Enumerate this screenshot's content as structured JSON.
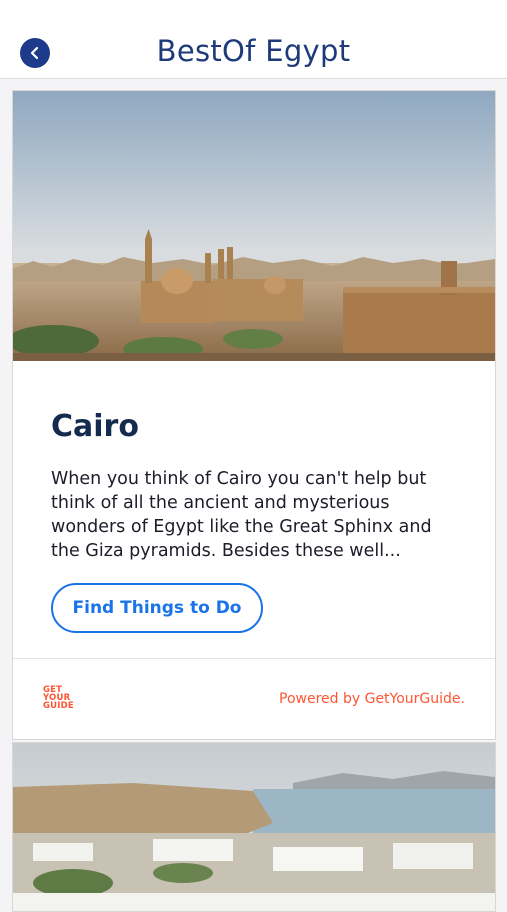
{
  "header": {
    "title": "BestOf Egypt",
    "back_icon": "chevron-left-icon"
  },
  "card": {
    "title": "Cairo",
    "description": "When you think of Cairo you can't help but think of all the ancient and mysterious wonders of Egypt like the Great Sphinx and the Giza pyramids. Besides these well...",
    "button_label": "Find Things to Do",
    "logo_lines": [
      "GET",
      "YOUR",
      "GUIDE"
    ],
    "powered_text": "Powered by GetYourGuide."
  },
  "colors": {
    "header_title": "#1e3a7a",
    "accent_blue": "#1a73e8",
    "brand_orange": "#ff5533",
    "back_button": "#1e3a8a"
  }
}
